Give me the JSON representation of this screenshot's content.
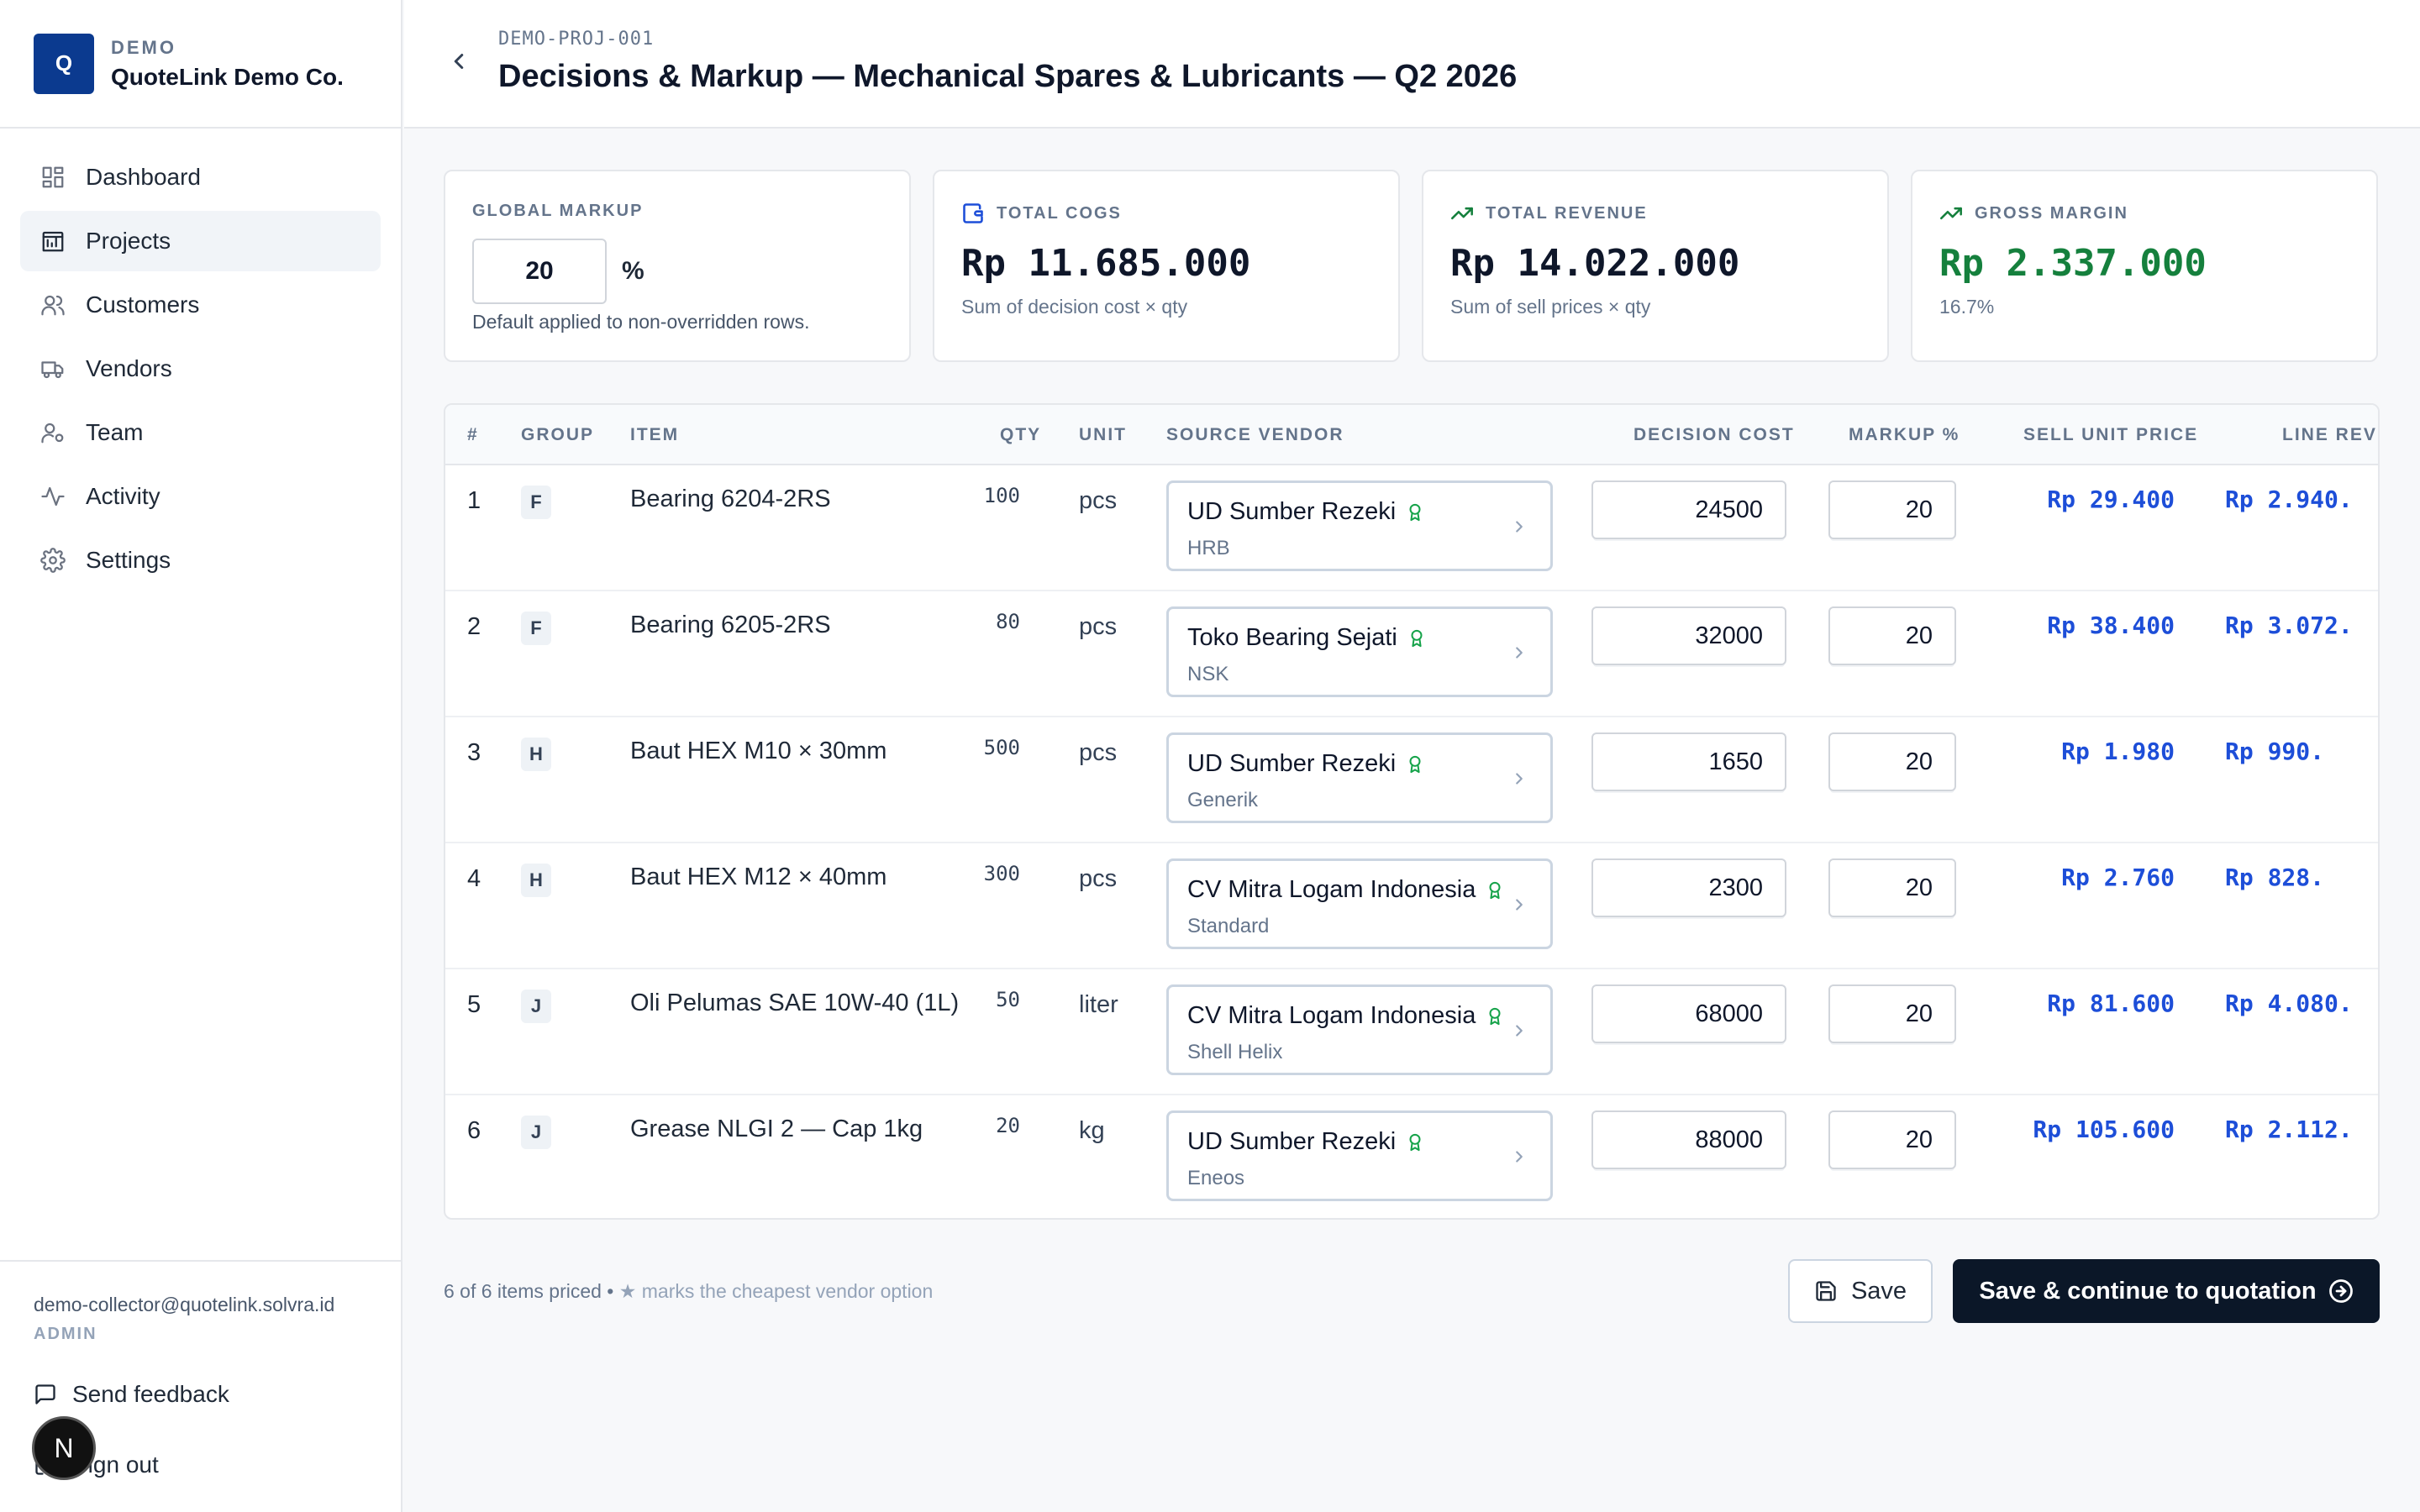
{
  "brand": {
    "logo_letter": "Q",
    "tag": "DEMO",
    "name": "QuoteLink Demo Co."
  },
  "nav": [
    {
      "label": "Dashboard",
      "icon": "dashboard-icon",
      "active": false
    },
    {
      "label": "Projects",
      "icon": "projects-icon",
      "active": true
    },
    {
      "label": "Customers",
      "icon": "customers-icon",
      "active": false
    },
    {
      "label": "Vendors",
      "icon": "truck-icon",
      "active": false
    },
    {
      "label": "Team",
      "icon": "team-icon",
      "active": false
    },
    {
      "label": "Activity",
      "icon": "activity-icon",
      "active": false
    },
    {
      "label": "Settings",
      "icon": "gear-icon",
      "active": false
    }
  ],
  "user": {
    "email": "demo-collector@quotelink.solvra.id",
    "role": "ADMIN"
  },
  "side_links": {
    "feedback": "Send feedback",
    "signout": "Sign out"
  },
  "dev_badge": "N",
  "header": {
    "project_code": "DEMO-PROJ-001",
    "title": "Decisions & Markup — Mechanical Spares & Lubricants — Q2 2026"
  },
  "cards": {
    "global_markup": {
      "label": "GLOBAL MARKUP",
      "value": "20",
      "unit": "%",
      "sub": "Default applied to non-overridden rows."
    },
    "cogs": {
      "label": "TOTAL COGS",
      "value": "Rp 11.685.000",
      "sub": "Sum of decision cost × qty"
    },
    "revenue": {
      "label": "TOTAL REVENUE",
      "value": "Rp 14.022.000",
      "sub": "Sum of sell prices × qty"
    },
    "margin": {
      "label": "GROSS MARGIN",
      "value": "Rp 2.337.000",
      "sub": "16.7%"
    }
  },
  "table": {
    "headers": {
      "num": "#",
      "group": "GROUP",
      "item": "ITEM",
      "qty": "QTY",
      "unit": "UNIT",
      "vendor": "SOURCE VENDOR",
      "cost": "DECISION COST",
      "markup": "MARKUP %",
      "sell": "SELL UNIT PRICE",
      "line": "LINE REVE"
    },
    "rows": [
      {
        "num": "1",
        "group": "F",
        "item": "Bearing 6204-2RS",
        "qty": "100",
        "unit": "pcs",
        "vendor": "UD Sumber Rezeki",
        "brand": "HRB",
        "cost": "24500",
        "markup": "20",
        "sell": "Rp 29.400",
        "line": "Rp 2.940."
      },
      {
        "num": "2",
        "group": "F",
        "item": "Bearing 6205-2RS",
        "qty": "80",
        "unit": "pcs",
        "vendor": "Toko Bearing Sejati",
        "brand": "NSK",
        "cost": "32000",
        "markup": "20",
        "sell": "Rp 38.400",
        "line": "Rp 3.072."
      },
      {
        "num": "3",
        "group": "H",
        "item": "Baut HEX M10 × 30mm",
        "qty": "500",
        "unit": "pcs",
        "vendor": "UD Sumber Rezeki",
        "brand": "Generik",
        "cost": "1650",
        "markup": "20",
        "sell": "Rp 1.980",
        "line": "Rp 990."
      },
      {
        "num": "4",
        "group": "H",
        "item": "Baut HEX M12 × 40mm",
        "qty": "300",
        "unit": "pcs",
        "vendor": "CV Mitra Logam Indonesia",
        "brand": "Standard",
        "cost": "2300",
        "markup": "20",
        "sell": "Rp 2.760",
        "line": "Rp 828."
      },
      {
        "num": "5",
        "group": "J",
        "item": "Oli Pelumas SAE 10W-40 (1L)",
        "qty": "50",
        "unit": "liter",
        "vendor": "CV Mitra Logam Indonesia",
        "brand": "Shell Helix",
        "cost": "68000",
        "markup": "20",
        "sell": "Rp 81.600",
        "line": "Rp 4.080."
      },
      {
        "num": "6",
        "group": "J",
        "item": "Grease NLGI 2 — Cap 1kg",
        "qty": "20",
        "unit": "kg",
        "vendor": "UD Sumber Rezeki",
        "brand": "Eneos",
        "cost": "88000",
        "markup": "20",
        "sell": "Rp 105.600",
        "line": "Rp 2.112."
      }
    ]
  },
  "footer": {
    "priced": "6 of 6 items priced •",
    "hint": "★ marks the cheapest vendor option",
    "save": "Save",
    "continue": "Save & continue to quotation"
  },
  "colors": {
    "brand": "#0b3a8f",
    "accent_blue": "#1d4ed8",
    "green": "#15803d",
    "primary_btn": "#0b1728"
  }
}
